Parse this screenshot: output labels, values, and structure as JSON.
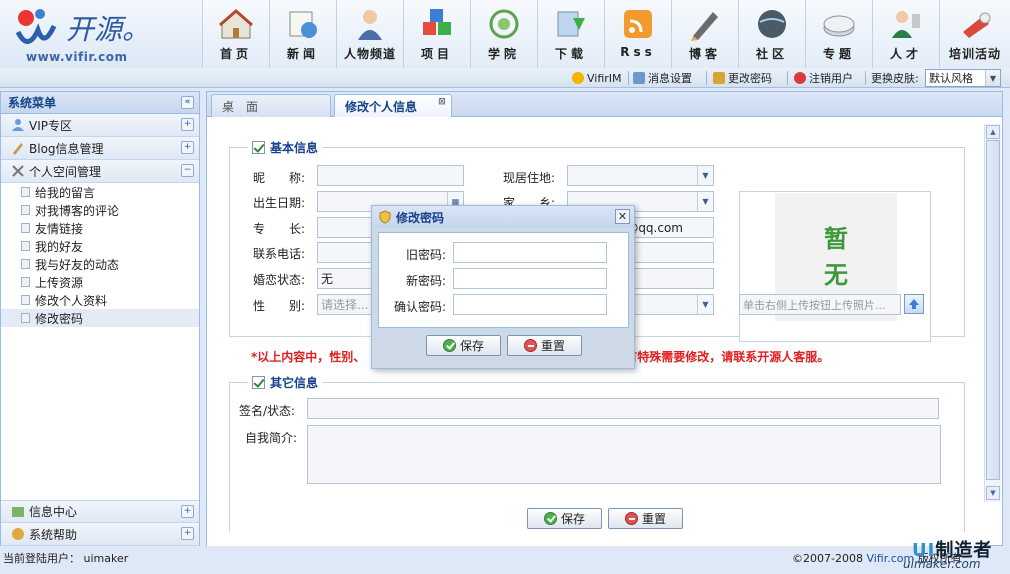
{
  "app": {
    "logo_text": "开源。",
    "logo_url": "www.vifir.com"
  },
  "nav": [
    {
      "label": "首页",
      "icon": "home-icon"
    },
    {
      "label": "新闻",
      "icon": "news-icon"
    },
    {
      "label": "人物频道",
      "icon": "person-icon"
    },
    {
      "label": "项目",
      "icon": "cubes-icon"
    },
    {
      "label": "学院",
      "icon": "college-icon"
    },
    {
      "label": "下载",
      "icon": "download-icon"
    },
    {
      "label": "Rss",
      "icon": "rss-icon"
    },
    {
      "label": "博客",
      "icon": "pen-icon"
    },
    {
      "label": "社区",
      "icon": "globe-icon"
    },
    {
      "label": "专题",
      "icon": "disc-icon"
    },
    {
      "label": "人才",
      "icon": "talent-icon"
    },
    {
      "label": "培训活动",
      "icon": "training-icon"
    }
  ],
  "toolbar": {
    "im": "VifirIM",
    "msg_settings": "消息设置",
    "change_password": "更改密码",
    "logout": "注销用户",
    "skin_label": "更换皮肤:",
    "skin_value": "默认风格"
  },
  "sidebar": {
    "title": "系统菜单",
    "groups": [
      {
        "label": "VIP专区"
      },
      {
        "label": "Blog信息管理"
      },
      {
        "label": "个人空间管理"
      }
    ],
    "items": [
      "给我的留言",
      "对我博客的评论",
      "友情链接",
      "我的好友",
      "我与好友的动态",
      "上传资源",
      "修改个人资料",
      "修改密码"
    ],
    "bottom_groups": [
      {
        "label": "信息中心"
      },
      {
        "label": "系统帮助"
      }
    ]
  },
  "tabs": [
    {
      "label": "桌　面"
    },
    {
      "label": "修改个人信息"
    }
  ],
  "form": {
    "basic_title": "基本信息",
    "nickname_label": "昵　　称:",
    "birthday_label": "出生日期:",
    "specialty_label": "专　　长:",
    "phone_label": "联系电话:",
    "marital_label": "婚恋状态:",
    "marital_value": "无",
    "gender_label": "性　　别:",
    "gender_placeholder": "请选择...",
    "residence_label": "现居住地:",
    "hometown_label": "家　　乡:",
    "email_value": "@qq.com",
    "photo_text_1": "暂",
    "photo_text_2": "无",
    "photo_hint": "单击右侧上传按钮上传照片...",
    "notice": "*以上内容中，性别、",
    "notice_tail": "有特殊需要修改，请联系开源人客服。",
    "other_title": "其它信息",
    "signature_label": "签名/状态:",
    "intro_label": "自我简介:",
    "save": "保存",
    "reset": "重置"
  },
  "dialog": {
    "title": "修改密码",
    "old_label": "旧密码:",
    "new_label": "新密码:",
    "confirm_label": "确认密码:",
    "save": "保存",
    "reset": "重置"
  },
  "footer": {
    "user_label": "当前登陆用户： uimaker",
    "copyright": "©2007-2008",
    "brand": "Vifir.com",
    "brand_tail": "版权所有"
  },
  "watermark": {
    "line1a": "UI",
    "line1b": "制造者",
    "line2": "uimaker.com"
  }
}
